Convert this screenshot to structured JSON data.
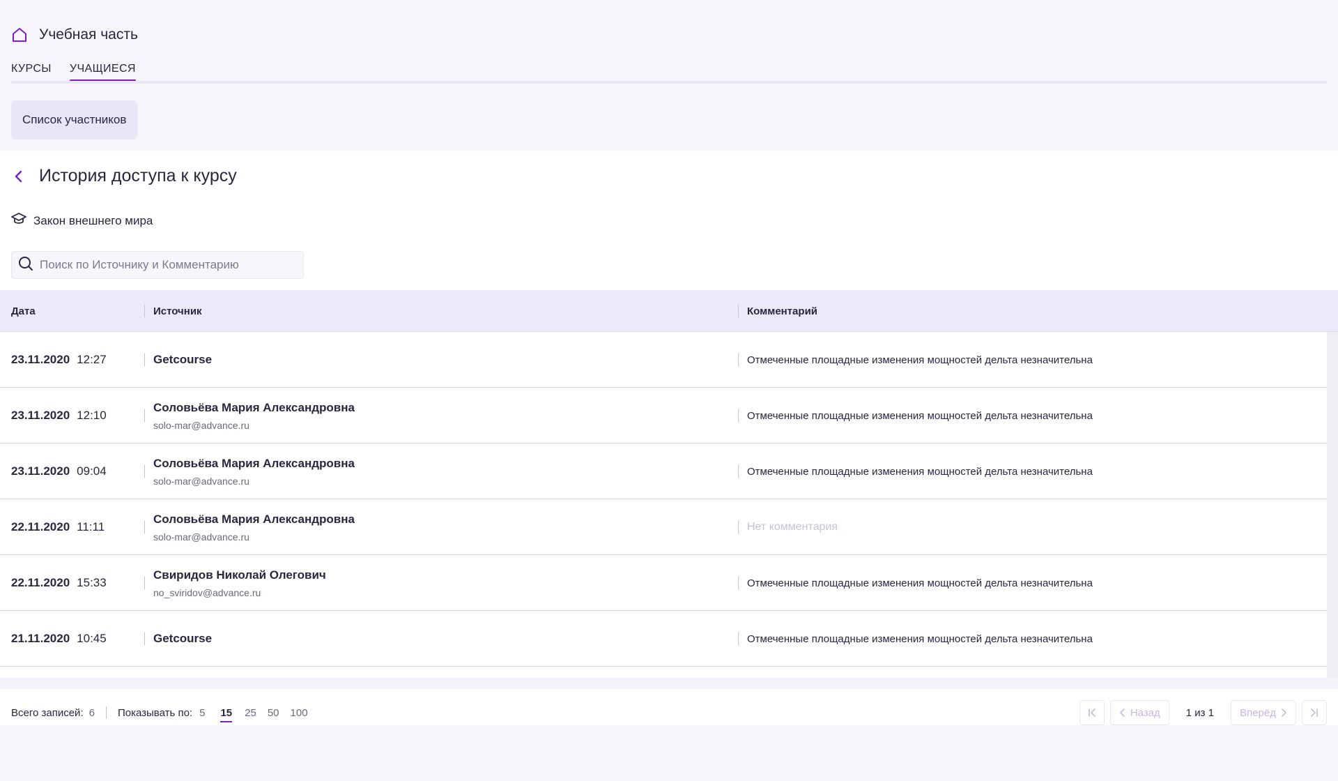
{
  "header": {
    "title": "Учебная часть",
    "home_icon": "home-icon"
  },
  "tabs": [
    {
      "label": "КУРСЫ",
      "active": false
    },
    {
      "label": "УЧАЩИЕСЯ",
      "active": true
    }
  ],
  "chip": {
    "label": "Список участников"
  },
  "page": {
    "title": "История доступа к курсу",
    "course": "Закон внешнего мира",
    "search_placeholder": "Поиск по Источнику и Комментарию"
  },
  "table": {
    "columns": [
      "Дата",
      "Источник",
      "Комментарий"
    ],
    "rows": [
      {
        "date": "23.11.2020",
        "time": "12:27",
        "source": "Getcourse",
        "email": "",
        "comment": "Отмеченные площадные изменения мощностей дельта незначительна"
      },
      {
        "date": "23.11.2020",
        "time": "12:10",
        "source": "Соловьёва Мария Александровна",
        "email": "solo-mar@advance.ru",
        "comment": "Отмеченные площадные изменения мощностей дельта незначительна"
      },
      {
        "date": "23.11.2020",
        "time": "09:04",
        "source": "Соловьёва Мария Александровна",
        "email": "solo-mar@advance.ru",
        "comment": "Отмеченные площадные изменения мощностей дельта незначительна"
      },
      {
        "date": "22.11.2020",
        "time": "11:11",
        "source": "Соловьёва Мария Александровна",
        "email": "solo-mar@advance.ru",
        "comment": "Нет комментария"
      },
      {
        "date": "22.11.2020",
        "time": "15:33",
        "source": "Свиридов Николай Олегович",
        "email": "no_sviridov@advance.ru",
        "comment": "Отмеченные площадные изменения мощностей дельта незначительна"
      },
      {
        "date": "21.11.2020",
        "time": "10:45",
        "source": "Getcourse",
        "email": "",
        "comment": "Отмеченные площадные изменения мощностей дельта незначительна"
      }
    ]
  },
  "footer": {
    "total_label": "Всего записей:",
    "total_value": "6",
    "per_page_label": "Показывать по:",
    "per_page_options": [
      "5",
      "15",
      "25",
      "50",
      "100"
    ],
    "per_page_selected": "15",
    "prev_label": "Назад",
    "next_label": "Вперёд",
    "page_info": "1 из 1"
  },
  "colors": {
    "accent": "#7a1fc6",
    "header_bg": "#ece9f8",
    "chip_bg": "#e9e4f6",
    "empty_comment": "#c8c2d6"
  }
}
